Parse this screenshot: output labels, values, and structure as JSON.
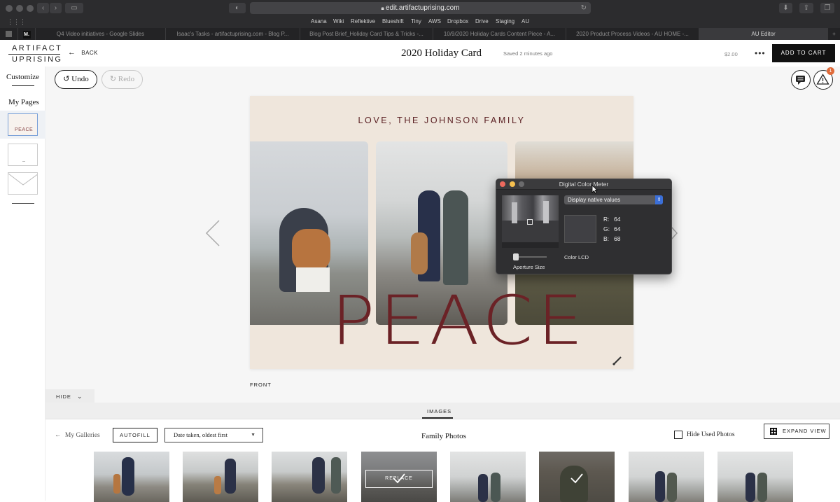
{
  "browser": {
    "url": "edit.artifactuprising.com",
    "bookmarks": [
      "Asana",
      "Wiki",
      "Reflektive",
      "Blueshift",
      "Tiny",
      "AWS",
      "Dropbox",
      "Drive",
      "Staging",
      "AU"
    ],
    "tabs": [
      "Q4 Video initiatives - Google Slides",
      "Isaac's Tasks - artifactuprising.com - Blog P...",
      "Blog Post Brief_Holiday Card Tips & Tricks -...",
      "10/9/2020 Holiday Cards Content Piece - A...",
      "2020 Product Process Videos - AU HOME -...",
      "AU Editor"
    ]
  },
  "header": {
    "logo_line1": "ARTIFACT",
    "logo_line2": "UPRISING",
    "back_label": "BACK",
    "title": "2020 Holiday Card",
    "saved": "Saved 2 minutes ago",
    "price": "$2.00",
    "add_to_cart": "ADD TO CART"
  },
  "sidebar": {
    "customize": "Customize",
    "my_pages": "My Pages",
    "page1_thumb_text": "PEACE"
  },
  "toolbar": {
    "undo": "Undo",
    "redo": "Redo",
    "alert_count": "1"
  },
  "card": {
    "headline": "LOVE, THE JOHNSON FAMILY",
    "big_text": "PEACE",
    "side_label": "FRONT"
  },
  "color_meter": {
    "title": "Digital Color Meter",
    "mode": "Display native values",
    "r_label": "R:",
    "r": "64",
    "g_label": "G:",
    "g": "64",
    "b_label": "B:",
    "b": "68",
    "aperture_label": "Aperture Size",
    "profile": "Color LCD",
    "swatch_color": "#404044"
  },
  "panel": {
    "hide_label": "HIDE",
    "tab_images": "IMAGES",
    "galleries": "My Galleries",
    "autofill": "AUTOFILL",
    "sort_selected": "Date taken, oldest first",
    "gallery_title": "Family Photos",
    "hide_used": "Hide Used Photos",
    "expand_view": "EXPAND VIEW",
    "replace": "REPLACE"
  },
  "colors": {
    "accent_dark_red": "#6b2226",
    "card_bg": "#efe6dc",
    "black": "#111111"
  }
}
